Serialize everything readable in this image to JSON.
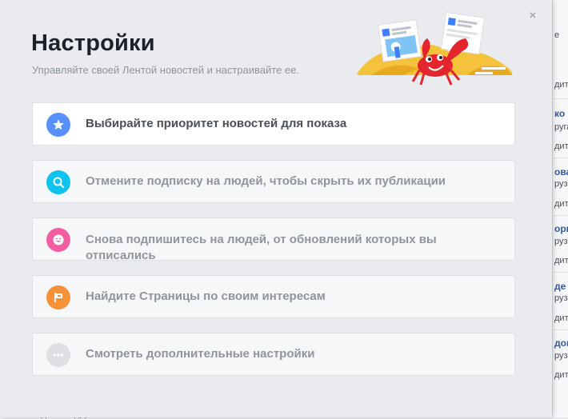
{
  "dialog": {
    "title": "Настройки",
    "subtitle": "Управляйте своей Лентой новостей и настраивайте ее.",
    "close_label": "×"
  },
  "options": [
    {
      "label": "Выбирайте приоритет новостей для показа",
      "icon": "star-icon",
      "color": "#5890ff"
    },
    {
      "label": "Отмените подписку на людей, чтобы скрыть их публикации",
      "icon": "search-icon",
      "color": "#10c3ee"
    },
    {
      "label": "Снова подпишитесь на людей, от обновлений которых вы отписались",
      "icon": "smile-icon",
      "color": "#f35ea1"
    },
    {
      "label": "Найдите Страницы по своим интересам",
      "icon": "flag-icon",
      "color": "#f7923b"
    },
    {
      "label": "Смотреть дополнительные настройки",
      "icon": "more-icon",
      "color": "#dddfe2"
    }
  ],
  "background": {
    "lines": [
      "е",
      "дит",
      "ко",
      "руга",
      "дит",
      "ова",
      "рузе",
      "дит",
      "орк",
      "рузе",
      "дит",
      "де",
      "рузе",
      "дит",
      "дов",
      "рузе",
      "дит"
    ],
    "bottom_text": "Подписки: друзья"
  }
}
